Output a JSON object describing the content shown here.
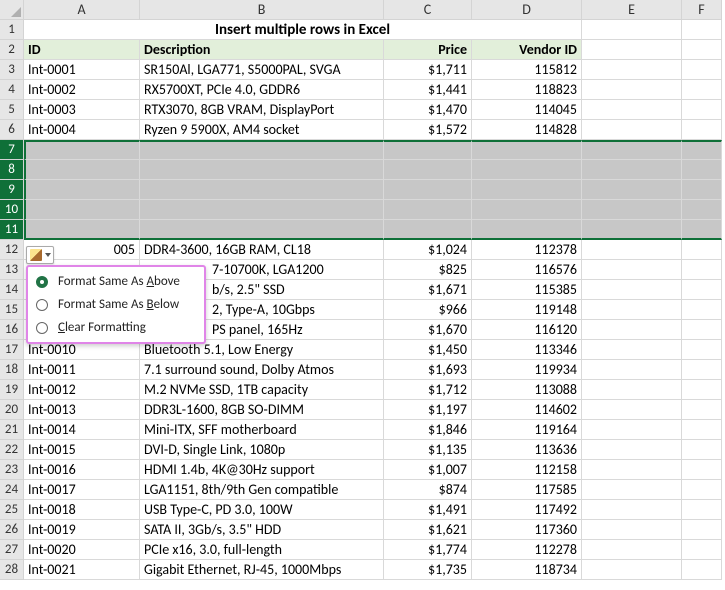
{
  "cols": [
    "A",
    "B",
    "C",
    "D",
    "E",
    "F"
  ],
  "title": "Insert multiple rows in Excel",
  "headers": {
    "id": "ID",
    "desc": "Description",
    "price": "Price",
    "vendor": "Vendor ID"
  },
  "rows": [
    {
      "n": 3,
      "id": "Int-0001",
      "desc": "SR150Al, LGA771, S5000PAL, SVGA",
      "price": "$1,711",
      "vendor": "115812"
    },
    {
      "n": 4,
      "id": "Int-0002",
      "desc": "RX5700XT, PCIe 4.0, GDDR6",
      "price": "$1,441",
      "vendor": "118823"
    },
    {
      "n": 5,
      "id": "Int-0003",
      "desc": "RTX3070, 8GB VRAM, DisplayPort",
      "price": "$1,470",
      "vendor": "114045"
    },
    {
      "n": 6,
      "id": "Int-0004",
      "desc": "Ryzen 9 5900X, AM4 socket",
      "price": "$1,572",
      "vendor": "114828"
    }
  ],
  "inserted_rows": [
    7,
    8,
    9,
    10,
    11
  ],
  "rows2": [
    {
      "n": 12,
      "id_partial": "005",
      "desc": "DDR4-3600, 16GB RAM, CL18",
      "price": "$1,024",
      "vendor": "112378"
    },
    {
      "n": 13,
      "desc_partial": "7-10700K, LGA1200",
      "price": "$825",
      "vendor": "116576"
    },
    {
      "n": 14,
      "desc_partial": "b/s, 2.5\" SSD",
      "price": "$1,671",
      "vendor": "115385"
    },
    {
      "n": 15,
      "desc_partial": " 2, Type-A, 10Gbps",
      "price": "$966",
      "vendor": "119148"
    },
    {
      "n": 16,
      "desc_partial": "PS panel, 165Hz",
      "price": "$1,670",
      "vendor": "116120"
    },
    {
      "n": 17,
      "id": "Int-0010",
      "desc": "Bluetooth 5.1, Low Energy",
      "price": "$1,450",
      "vendor": "113346"
    },
    {
      "n": 18,
      "id": "Int-0011",
      "desc": "7.1 surround sound, Dolby Atmos",
      "price": "$1,693",
      "vendor": "119934"
    },
    {
      "n": 19,
      "id": "Int-0012",
      "desc": "M.2 NVMe SSD, 1TB capacity",
      "price": "$1,712",
      "vendor": "113088"
    },
    {
      "n": 20,
      "id": "Int-0013",
      "desc": "DDR3L-1600, 8GB SO-DIMM",
      "price": "$1,197",
      "vendor": "114602"
    },
    {
      "n": 21,
      "id": "Int-0014",
      "desc": "Mini-ITX, SFF motherboard",
      "price": "$1,846",
      "vendor": "119164"
    },
    {
      "n": 22,
      "id": "Int-0015",
      "desc": "DVI-D, Single Link, 1080p",
      "price": "$1,135",
      "vendor": "113636"
    },
    {
      "n": 23,
      "id": "Int-0016",
      "desc": "HDMI 1.4b, 4K@30Hz support",
      "price": "$1,007",
      "vendor": "112158"
    },
    {
      "n": 24,
      "id": "Int-0017",
      "desc": "LGA1151, 8th/9th Gen compatible",
      "price": "$874",
      "vendor": "117585"
    },
    {
      "n": 25,
      "id": "Int-0018",
      "desc": "USB Type-C, PD 3.0, 100W",
      "price": "$1,491",
      "vendor": "117492"
    },
    {
      "n": 26,
      "id": "Int-0019",
      "desc": "SATA II, 3Gb/s, 3.5\" HDD",
      "price": "$1,621",
      "vendor": "117360"
    },
    {
      "n": 27,
      "id": "Int-0020",
      "desc": "PCIe x16, 3.0, full-length",
      "price": "$1,774",
      "vendor": "112278"
    },
    {
      "n": 28,
      "id": "Int-0021",
      "desc": "Gigabit Ethernet, RJ-45, 1000Mbps",
      "price": "$1,735",
      "vendor": "118734"
    }
  ],
  "menu": {
    "above": "Format Same As Above",
    "below": "Format Same As Below",
    "clear": "Clear Formatting",
    "mn_above": "A",
    "mn_below": "B",
    "mn_clear": "C"
  }
}
